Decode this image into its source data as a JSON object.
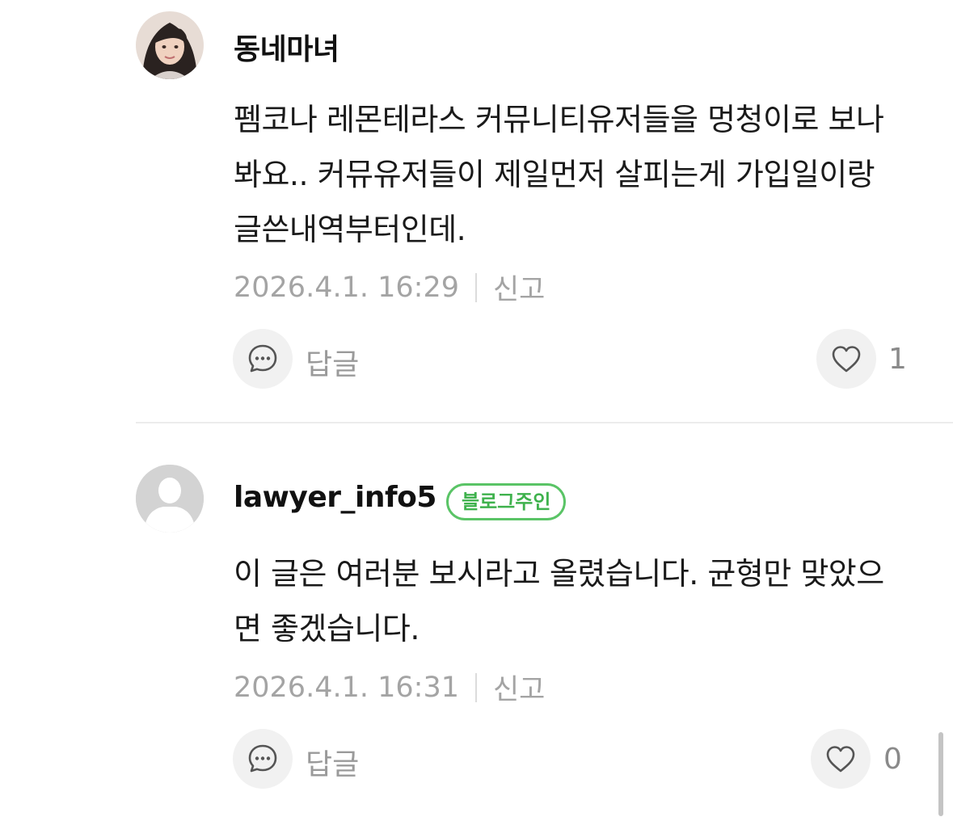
{
  "comments": [
    {
      "author": "동네마녀",
      "text": "펨코나 레몬테라스 커뮤니티유저들을 멍청이로 보나봐요.. 커뮤유저들이 제일먼저 살피는게 가입일이랑 글쓴내역부터인데.",
      "timestamp": "2026.4.1. 16:29",
      "report_label": "신고",
      "reply_label": "답글",
      "like_count": "1",
      "avatar_icon": "user-photo-avatar"
    },
    {
      "author": "lawyer_info5",
      "badge": "블로그주인",
      "text": "이 글은 여러분 보시라고 올렸습니다. 균형만 맞았으면 좋겠습니다.",
      "timestamp": "2026.4.1. 16:31",
      "report_label": "신고",
      "reply_label": "답글",
      "like_count": "0",
      "avatar_icon": "default-user-avatar"
    }
  ],
  "colors": {
    "badge_accent": "#3fb24d",
    "meta_text": "#a4a4a4",
    "button_bg": "#f1f1f1"
  }
}
